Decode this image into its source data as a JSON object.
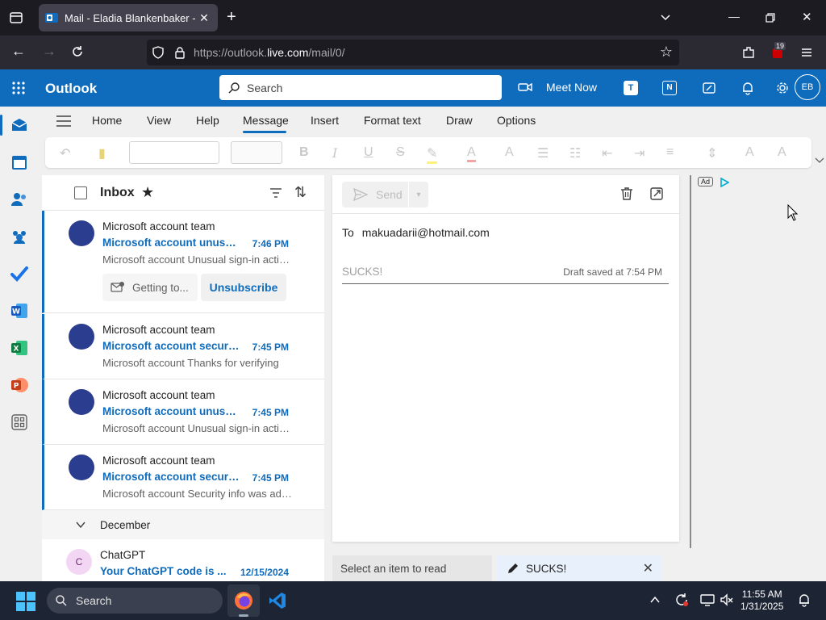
{
  "browser": {
    "tab_title": "Mail - Eladia Blankenbaker - Outlook",
    "url_prefix": "https://outlook.",
    "url_domain": "live.com",
    "url_path": "/mail/0/",
    "extension_badge": "19"
  },
  "header": {
    "brand": "Outlook",
    "search_placeholder": "Search",
    "meet_now": "Meet Now",
    "avatar_initials": "EB"
  },
  "ribbon": {
    "tabs": [
      "Home",
      "View",
      "Help",
      "Message",
      "Insert",
      "Format text",
      "Draw",
      "Options"
    ],
    "active_tab": "Message"
  },
  "list": {
    "folder": "Inbox",
    "mails": [
      {
        "sender": "Microsoft account team",
        "subject": "Microsoft account unusual sign-in activity",
        "time": "7:46 PM",
        "preview": "Microsoft account Unusual sign-in activity",
        "chip": "Getting to...",
        "action": "Unsubscribe"
      },
      {
        "sender": "Microsoft account team",
        "subject": "Microsoft account security info verification",
        "time": "7:45 PM",
        "preview": "Microsoft account Thanks for verifying"
      },
      {
        "sender": "Microsoft account team",
        "subject": "Microsoft account unusual sign-in activity",
        "time": "7:45 PM",
        "preview": "Microsoft account Unusual sign-in activity"
      },
      {
        "sender": "Microsoft account team",
        "subject": "Microsoft account security info was added",
        "time": "7:45 PM",
        "preview": "Microsoft account Security info was added"
      }
    ],
    "group_label": "December",
    "older": {
      "initial": "C",
      "sender": "ChatGPT",
      "subject": "Your ChatGPT code is ...",
      "time": "12/15/2024"
    }
  },
  "compose": {
    "send_label": "Send",
    "to_label": "To",
    "to_value": "makuadarii@hotmail.com",
    "subject": "SUCKS!",
    "draft_status": "Draft saved at 7:54 PM"
  },
  "ad": {
    "badge": "Ad"
  },
  "bottom_tabs": {
    "read": "Select an item to read",
    "draft": "SUCKS!"
  },
  "taskbar": {
    "search": "Search",
    "time": "11:55 AM",
    "date": "1/31/2025"
  },
  "colors": {
    "brand": "#0f6cbd",
    "avatar": "#2b3d8f"
  }
}
